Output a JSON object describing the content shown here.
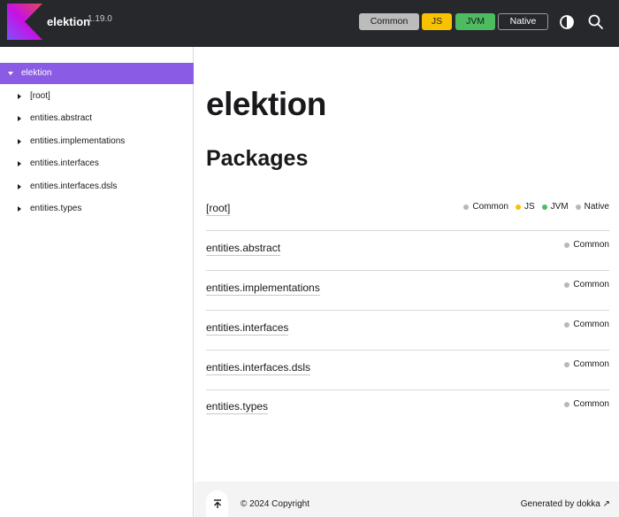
{
  "header": {
    "brand": "elektion",
    "version": "1.19.0",
    "filters": [
      {
        "label": "Common",
        "color": "#bcbcbc"
      },
      {
        "label": "JS",
        "color": "#f9c200"
      },
      {
        "label": "JVM",
        "color": "#4dbb5f"
      },
      {
        "label": "Native",
        "color": "#27282c"
      }
    ],
    "icons": {
      "theme": "theme-toggle-icon",
      "search": "search-icon"
    }
  },
  "sidebar": {
    "items": [
      {
        "label": "elektion",
        "selected": true
      },
      {
        "label": "[root]"
      },
      {
        "label": "entities.abstract"
      },
      {
        "label": "entities.implementations"
      },
      {
        "label": "entities.interfaces"
      },
      {
        "label": "entities.interfaces.dsls"
      },
      {
        "label": "entities.types"
      }
    ]
  },
  "main": {
    "title": "elektion",
    "section_title": "Packages",
    "packages": [
      {
        "name": "[root]",
        "platforms": [
          {
            "label": "Common",
            "color": "#b8b8b8"
          },
          {
            "label": "JS",
            "color": "#f9c200"
          },
          {
            "label": "JVM",
            "color": "#4dbb5f"
          },
          {
            "label": "Native",
            "color": "#b8b8b8"
          }
        ]
      },
      {
        "name": "entities.abstract",
        "platforms": [
          {
            "label": "Common",
            "color": "#b8b8b8"
          }
        ]
      },
      {
        "name": "entities.implementations",
        "platforms": [
          {
            "label": "Common",
            "color": "#b8b8b8"
          }
        ]
      },
      {
        "name": "entities.interfaces",
        "platforms": [
          {
            "label": "Common",
            "color": "#b8b8b8"
          }
        ]
      },
      {
        "name": "entities.interfaces.dsls",
        "platforms": [
          {
            "label": "Common",
            "color": "#b8b8b8"
          }
        ]
      },
      {
        "name": "entities.types",
        "platforms": [
          {
            "label": "Common",
            "color": "#b8b8b8"
          }
        ]
      }
    ]
  },
  "footer": {
    "copyright": "© 2024 Copyright",
    "generated_prefix": "Generated by",
    "generated_link": "dokka",
    "link_arrow": "↗"
  },
  "colors": {
    "accent": "#8a5ce6",
    "header_bg": "#27282c"
  }
}
